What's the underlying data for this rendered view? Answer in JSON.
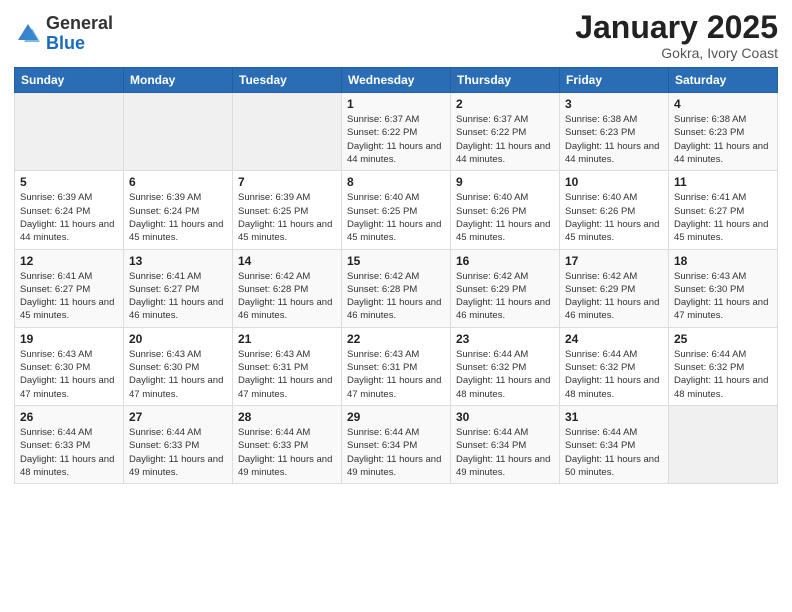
{
  "header": {
    "logo_general": "General",
    "logo_blue": "Blue",
    "month_title": "January 2025",
    "subtitle": "Gokra, Ivory Coast"
  },
  "days_of_week": [
    "Sunday",
    "Monday",
    "Tuesday",
    "Wednesday",
    "Thursday",
    "Friday",
    "Saturday"
  ],
  "weeks": [
    [
      {
        "day": "",
        "info": ""
      },
      {
        "day": "",
        "info": ""
      },
      {
        "day": "",
        "info": ""
      },
      {
        "day": "1",
        "info": "Sunrise: 6:37 AM\nSunset: 6:22 PM\nDaylight: 11 hours and 44 minutes."
      },
      {
        "day": "2",
        "info": "Sunrise: 6:37 AM\nSunset: 6:22 PM\nDaylight: 11 hours and 44 minutes."
      },
      {
        "day": "3",
        "info": "Sunrise: 6:38 AM\nSunset: 6:23 PM\nDaylight: 11 hours and 44 minutes."
      },
      {
        "day": "4",
        "info": "Sunrise: 6:38 AM\nSunset: 6:23 PM\nDaylight: 11 hours and 44 minutes."
      }
    ],
    [
      {
        "day": "5",
        "info": "Sunrise: 6:39 AM\nSunset: 6:24 PM\nDaylight: 11 hours and 44 minutes."
      },
      {
        "day": "6",
        "info": "Sunrise: 6:39 AM\nSunset: 6:24 PM\nDaylight: 11 hours and 45 minutes."
      },
      {
        "day": "7",
        "info": "Sunrise: 6:39 AM\nSunset: 6:25 PM\nDaylight: 11 hours and 45 minutes."
      },
      {
        "day": "8",
        "info": "Sunrise: 6:40 AM\nSunset: 6:25 PM\nDaylight: 11 hours and 45 minutes."
      },
      {
        "day": "9",
        "info": "Sunrise: 6:40 AM\nSunset: 6:26 PM\nDaylight: 11 hours and 45 minutes."
      },
      {
        "day": "10",
        "info": "Sunrise: 6:40 AM\nSunset: 6:26 PM\nDaylight: 11 hours and 45 minutes."
      },
      {
        "day": "11",
        "info": "Sunrise: 6:41 AM\nSunset: 6:27 PM\nDaylight: 11 hours and 45 minutes."
      }
    ],
    [
      {
        "day": "12",
        "info": "Sunrise: 6:41 AM\nSunset: 6:27 PM\nDaylight: 11 hours and 45 minutes."
      },
      {
        "day": "13",
        "info": "Sunrise: 6:41 AM\nSunset: 6:27 PM\nDaylight: 11 hours and 46 minutes."
      },
      {
        "day": "14",
        "info": "Sunrise: 6:42 AM\nSunset: 6:28 PM\nDaylight: 11 hours and 46 minutes."
      },
      {
        "day": "15",
        "info": "Sunrise: 6:42 AM\nSunset: 6:28 PM\nDaylight: 11 hours and 46 minutes."
      },
      {
        "day": "16",
        "info": "Sunrise: 6:42 AM\nSunset: 6:29 PM\nDaylight: 11 hours and 46 minutes."
      },
      {
        "day": "17",
        "info": "Sunrise: 6:42 AM\nSunset: 6:29 PM\nDaylight: 11 hours and 46 minutes."
      },
      {
        "day": "18",
        "info": "Sunrise: 6:43 AM\nSunset: 6:30 PM\nDaylight: 11 hours and 47 minutes."
      }
    ],
    [
      {
        "day": "19",
        "info": "Sunrise: 6:43 AM\nSunset: 6:30 PM\nDaylight: 11 hours and 47 minutes."
      },
      {
        "day": "20",
        "info": "Sunrise: 6:43 AM\nSunset: 6:30 PM\nDaylight: 11 hours and 47 minutes."
      },
      {
        "day": "21",
        "info": "Sunrise: 6:43 AM\nSunset: 6:31 PM\nDaylight: 11 hours and 47 minutes."
      },
      {
        "day": "22",
        "info": "Sunrise: 6:43 AM\nSunset: 6:31 PM\nDaylight: 11 hours and 47 minutes."
      },
      {
        "day": "23",
        "info": "Sunrise: 6:44 AM\nSunset: 6:32 PM\nDaylight: 11 hours and 48 minutes."
      },
      {
        "day": "24",
        "info": "Sunrise: 6:44 AM\nSunset: 6:32 PM\nDaylight: 11 hours and 48 minutes."
      },
      {
        "day": "25",
        "info": "Sunrise: 6:44 AM\nSunset: 6:32 PM\nDaylight: 11 hours and 48 minutes."
      }
    ],
    [
      {
        "day": "26",
        "info": "Sunrise: 6:44 AM\nSunset: 6:33 PM\nDaylight: 11 hours and 48 minutes."
      },
      {
        "day": "27",
        "info": "Sunrise: 6:44 AM\nSunset: 6:33 PM\nDaylight: 11 hours and 49 minutes."
      },
      {
        "day": "28",
        "info": "Sunrise: 6:44 AM\nSunset: 6:33 PM\nDaylight: 11 hours and 49 minutes."
      },
      {
        "day": "29",
        "info": "Sunrise: 6:44 AM\nSunset: 6:34 PM\nDaylight: 11 hours and 49 minutes."
      },
      {
        "day": "30",
        "info": "Sunrise: 6:44 AM\nSunset: 6:34 PM\nDaylight: 11 hours and 49 minutes."
      },
      {
        "day": "31",
        "info": "Sunrise: 6:44 AM\nSunset: 6:34 PM\nDaylight: 11 hours and 50 minutes."
      },
      {
        "day": "",
        "info": ""
      }
    ]
  ]
}
